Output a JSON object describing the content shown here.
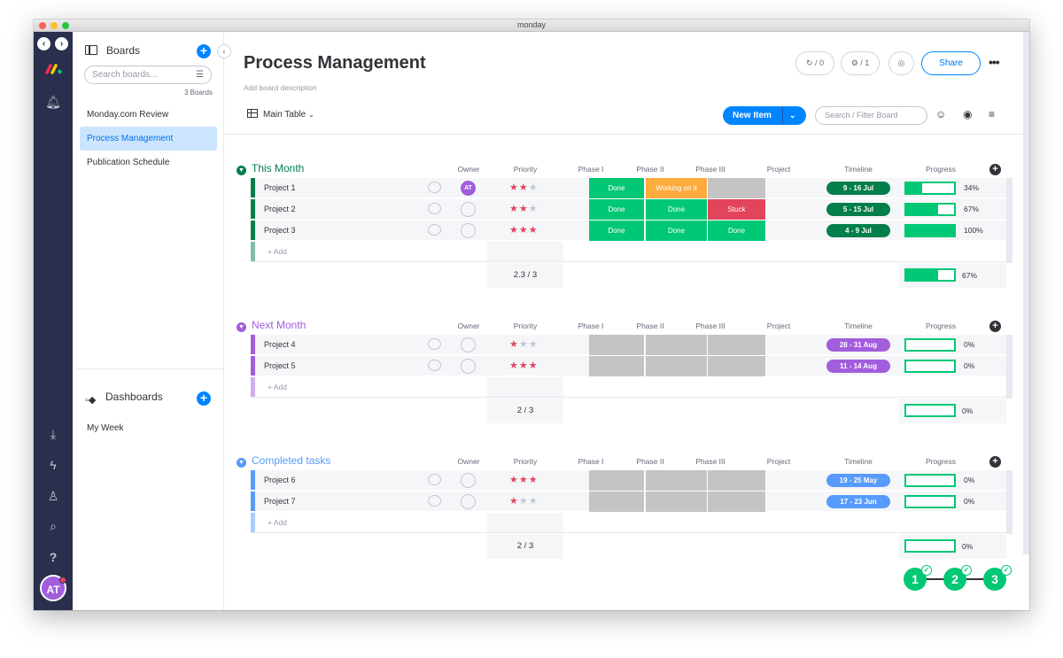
{
  "window": {
    "title": "monday"
  },
  "sidebar": {
    "boards_title": "Boards",
    "search_placeholder": "Search boards...",
    "board_count": "3 Boards",
    "boards": [
      "Monday.com Review",
      "Process Management",
      "Publication Schedule"
    ],
    "dashboards_title": "Dashboards",
    "dashboards": [
      "My Week"
    ]
  },
  "user": {
    "initials": "AT"
  },
  "header": {
    "title": "Process Management",
    "description": "Add board description",
    "activity_count": "/ 0",
    "integrations_count": "/ 1",
    "share": "Share",
    "view": "Main Table",
    "new_item": "New Item",
    "filter_placeholder": "Search / Filter Board"
  },
  "columns": [
    "Owner",
    "Priority",
    "Phase I",
    "Phase II",
    "Phase III",
    "Project",
    "Timeline",
    "Progress"
  ],
  "add_row_label": "+ Add",
  "groups": [
    {
      "name": "This Month",
      "color": "#037f4c",
      "rows": [
        {
          "name": "Project 1",
          "owner": "AT",
          "stars": 2,
          "phases": [
            [
              "Done",
              "#00c875"
            ],
            [
              "Working on it",
              "#fdab3d"
            ],
            [
              "",
              "#c4c4c4"
            ]
          ],
          "timeline": "9 - 16 Jul",
          "progress": 34,
          "progress_label": "34%"
        },
        {
          "name": "Project 2",
          "owner": "",
          "stars": 2,
          "phases": [
            [
              "Done",
              "#00c875"
            ],
            [
              "Done",
              "#00c875"
            ],
            [
              "Stuck",
              "#e2445c"
            ]
          ],
          "timeline": "5 - 15 Jul",
          "progress": 67,
          "progress_label": "67%"
        },
        {
          "name": "Project 3",
          "owner": "",
          "stars": 3,
          "phases": [
            [
              "Done",
              "#00c875"
            ],
            [
              "Done",
              "#00c875"
            ],
            [
              "Done",
              "#00c875"
            ]
          ],
          "timeline": "4 - 9 Jul",
          "progress": 100,
          "progress_label": "100%"
        }
      ],
      "summary_priority": "2.3 / 3",
      "summary_progress": 67,
      "summary_progress_label": "67%"
    },
    {
      "name": "Next Month",
      "color": "#a25ddc",
      "rows": [
        {
          "name": "Project 4",
          "owner": "",
          "stars": 1,
          "phases": [
            [
              "",
              "#c4c4c4"
            ],
            [
              "",
              "#c4c4c4"
            ],
            [
              "",
              "#c4c4c4"
            ]
          ],
          "timeline": "28 - 31 Aug",
          "progress": 0,
          "progress_label": "0%"
        },
        {
          "name": "Project 5",
          "owner": "",
          "stars": 3,
          "phases": [
            [
              "",
              "#c4c4c4"
            ],
            [
              "",
              "#c4c4c4"
            ],
            [
              "",
              "#c4c4c4"
            ]
          ],
          "timeline": "11 - 14 Aug",
          "progress": 0,
          "progress_label": "0%"
        }
      ],
      "summary_priority": "2 / 3",
      "summary_progress": 0,
      "summary_progress_label": "0%"
    },
    {
      "name": "Completed tasks",
      "color": "#579bfc",
      "rows": [
        {
          "name": "Project 6",
          "owner": "",
          "stars": 3,
          "phases": [
            [
              "",
              "#c4c4c4"
            ],
            [
              "",
              "#c4c4c4"
            ],
            [
              "",
              "#c4c4c4"
            ]
          ],
          "timeline": "19 - 25 May",
          "progress": 0,
          "progress_label": "0%"
        },
        {
          "name": "Project 7",
          "owner": "",
          "stars": 1,
          "phases": [
            [
              "",
              "#c4c4c4"
            ],
            [
              "",
              "#c4c4c4"
            ],
            [
              "",
              "#c4c4c4"
            ]
          ],
          "timeline": "17 - 23 Jun",
          "progress": 0,
          "progress_label": "0%"
        }
      ],
      "summary_priority": "2 / 3",
      "summary_progress": 0,
      "summary_progress_label": "0%"
    }
  ],
  "steps": [
    "1",
    "2",
    "3"
  ]
}
